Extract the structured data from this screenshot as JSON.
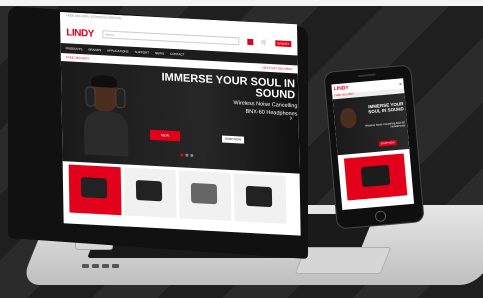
{
  "laptop_site": {
    "topbar": "FREE DELIVERY & EXPRESS SERVICE",
    "logo": "LINDY",
    "search_placeholder": "Search",
    "basket": "BASKET",
    "nav": [
      "PRODUCTS",
      "BRANDS",
      "APPLICATIONS",
      "SUPPORT",
      "NEWS",
      "CONTACT"
    ],
    "promo_left": "FREE DELIVERY",
    "promo_right": "NEXT DAY DELIVERY",
    "hero": {
      "title": "IMMERSE YOUR SOUL IN SOUND",
      "subtitle": "Wireless Noise Cancelling",
      "subtitle2": "BNX-60 Headphones",
      "badge": "NEW",
      "shop": "SHOP NOW",
      "arrow_right": "›"
    }
  },
  "phone_site": {
    "logo": "LINDY",
    "menu": "≡",
    "strip": "FREE DELIVERY",
    "hero_title": "IMMERSE YOUR SOUL IN SOUND",
    "hero_sub": "Wireless Noise Cancelling BNX-60 Headphones",
    "shop": "SHOP NOW"
  },
  "colors": {
    "brand": "#e2001a",
    "dark": "#1c1c1c",
    "background": "#232323"
  }
}
